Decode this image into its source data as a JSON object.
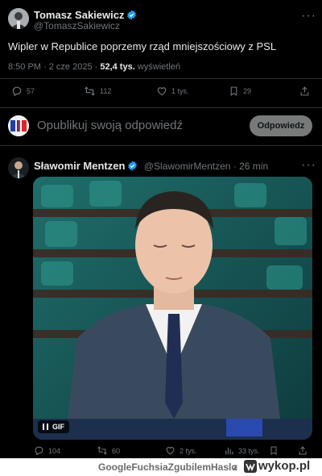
{
  "main_tweet": {
    "author_name": "Tomasz Sakiewicz",
    "author_handle": "@TomaszSakiewicz",
    "text": "Wipler w Republice poprzemy rząd mniejszościowy z PSL",
    "time": "8:50 PM · 2 cze 2025 · ",
    "views": "52,4 tys.",
    "views_label": " wyświetleń",
    "more": "···",
    "stats": {
      "replies": "57",
      "reposts": "112",
      "likes": "1 tys.",
      "bookmarks": "29"
    }
  },
  "reply_box": {
    "placeholder": "Opublikuj swoją odpowiedź",
    "button_label": "Odpowiedz"
  },
  "reply_tweet": {
    "author_name": "Sławomir Mentzen",
    "author_handle": "@SlawomirMentzen",
    "time": " · 26 min",
    "more": "···",
    "gif_label": "GIF",
    "stats": {
      "replies": "104",
      "reposts": "60",
      "likes": "2 tys.",
      "views": "33 tys."
    }
  },
  "footer": {
    "username": "GoogleFuchsiaZgubilemHaslo",
    "separator": "z",
    "site": "wykop.pl"
  },
  "colors": {
    "background": "#000000",
    "text_primary": "#e7e9ea",
    "text_secondary": "#71767b",
    "verified": "#1d9bf0",
    "divider": "#2f3336"
  }
}
